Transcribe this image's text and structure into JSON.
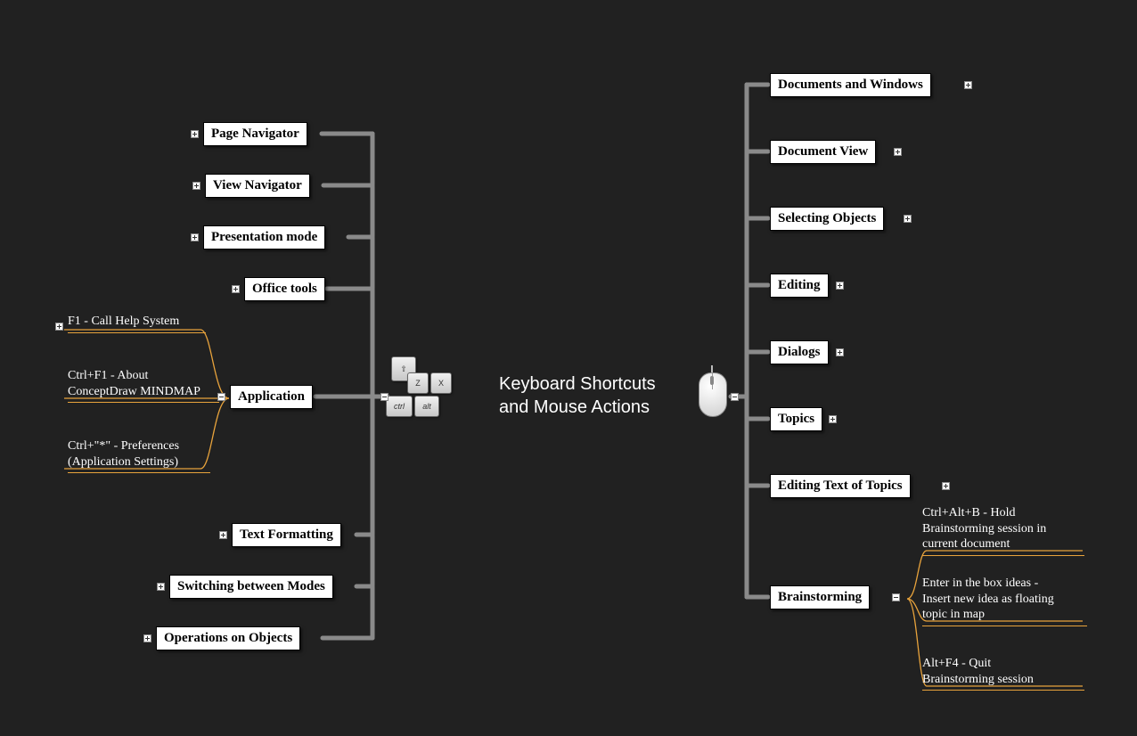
{
  "central": {
    "line1": "Keyboard Shortcuts",
    "line2": "and Mouse Actions"
  },
  "left_nodes": {
    "page_navigator": "Page Navigator",
    "view_navigator": "View Navigator",
    "presentation_mode": "Presentation mode",
    "office_tools": "Office tools",
    "application": "Application",
    "text_formatting": "Text Formatting",
    "switching_modes": "Switching between Modes",
    "operations_objects": "Operations on Objects"
  },
  "right_nodes": {
    "documents_windows": "Documents and Windows",
    "document_view": "Document View",
    "selecting_objects": "Selecting Objects",
    "editing": "Editing",
    "dialogs": "Dialogs",
    "topics": "Topics",
    "editing_text_topics": "Editing Text of Topics",
    "brainstorming": "Brainstorming"
  },
  "application_leaves": {
    "a": "F1 - Call Help System",
    "b_line1": "Ctrl+F1 - About",
    "b_line2": "ConceptDraw MINDMAP",
    "c_line1": "Ctrl+\"*\" - Preferences",
    "c_line2": "(Application Settings)"
  },
  "brainstorming_leaves": {
    "a_line1": "Ctrl+Alt+B - Hold",
    "a_line2": "Brainstorming session in",
    "a_line3": "current document",
    "b_line1": "Enter in the box ideas -",
    "b_line2": "Insert new idea as floating",
    "b_line3": "topic in map",
    "c_line1": "Alt+F4 - Quit",
    "c_line2": "Brainstorming session"
  }
}
